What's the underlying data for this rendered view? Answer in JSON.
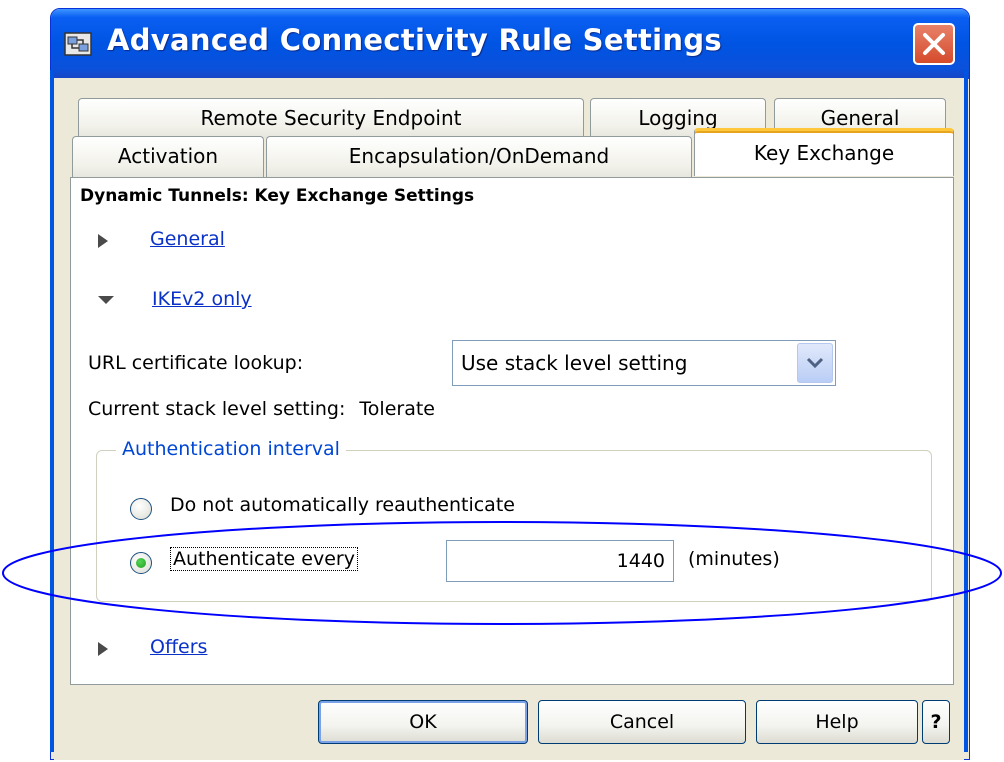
{
  "window": {
    "title": "Advanced Connectivity Rule Settings"
  },
  "tabs": {
    "row1": [
      {
        "id": "remote-security-endpoint",
        "label": "Remote Security Endpoint"
      },
      {
        "id": "logging",
        "label": "Logging"
      },
      {
        "id": "general",
        "label": "General"
      }
    ],
    "row2": [
      {
        "id": "activation",
        "label": "Activation"
      },
      {
        "id": "encapsulation",
        "label": "Encapsulation/OnDemand"
      },
      {
        "id": "key-exchange",
        "label": "Key Exchange",
        "active": true
      }
    ]
  },
  "panel": {
    "heading": "Dynamic Tunnels: Key Exchange Settings",
    "sections": {
      "general": {
        "label": "General",
        "expanded": false
      },
      "ikev2": {
        "label": "IKEv2 only",
        "expanded": true
      },
      "offers": {
        "label": "Offers",
        "expanded": false
      }
    },
    "url_lookup": {
      "label": "URL certificate lookup:",
      "selected": "Use stack level setting"
    },
    "stack_setting": {
      "label": "Current stack level setting:",
      "value": "Tolerate"
    },
    "auth_interval": {
      "title": "Authentication interval",
      "option_none": "Do not automatically reauthenticate",
      "option_every": "Authenticate every",
      "selected": "every",
      "minutes_value": "1440",
      "unit": "(minutes)"
    }
  },
  "buttons": {
    "ok": "OK",
    "cancel": "Cancel",
    "help": "Help",
    "question": "?"
  },
  "colors": {
    "titlebar": "#0054e3",
    "link": "#0b32c8",
    "group_title": "#0046d5",
    "annotation": "#0000ff",
    "active_tab_accent": "#ffc83c"
  }
}
